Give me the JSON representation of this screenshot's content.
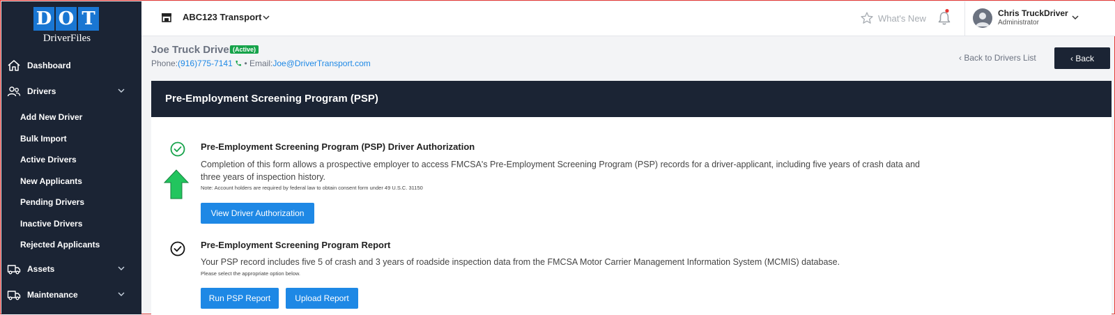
{
  "sidebar": {
    "logo_letters": [
      "D",
      "O",
      "T"
    ],
    "logo_sub": "DriverFiles",
    "items": [
      {
        "label": "Dashboard",
        "icon": "home-icon"
      },
      {
        "label": "Drivers",
        "icon": "users-icon"
      },
      {
        "label": "Assets",
        "icon": "truck-icon"
      },
      {
        "label": "Maintenance",
        "icon": "truck-icon"
      }
    ],
    "sub_items": [
      "Add New Driver",
      "Bulk Import",
      "Active Drivers",
      "New Applicants",
      "Pending Drivers",
      "Inactive Drivers",
      "Rejected Applicants"
    ]
  },
  "topbar": {
    "company": "ABC123 Transport",
    "whats_new": "What's New",
    "user_name": "Chris TruckDriver",
    "user_role": "Administrator"
  },
  "driver": {
    "name": "Joe Truck Driver",
    "status": "(Active)",
    "phone_label": "Phone:",
    "phone": "(916)775-7141",
    "email_label": "Email:",
    "email": "Joe@DriverTransport.com"
  },
  "nav": {
    "back_link": "Back to Drivers List",
    "back_button": "Back"
  },
  "panel": {
    "title": "Pre-Employment Screening Program (PSP)",
    "sections": [
      {
        "title": "Pre-Employment Screening Program (PSP) Driver Authorization",
        "desc_line1": "Completion of this form allows a prospective employer to access FMCSA's Pre-Employment Screening Program (PSP) records for a driver-applicant, including five years of crash data and",
        "desc_line2": "three years of inspection history.",
        "note": "Note: Account holders are required by federal law to obtain consent form under 49 U.S.C. 31150",
        "button": "View Driver Authorization"
      },
      {
        "title": "Pre-Employment Screening Program Report",
        "desc_line1": "Your PSP record includes five 5 of crash and 3 years of roadside inspection data from the FMCSA Motor Carrier Management Information System (MCMIS) database.",
        "note": "Please select the appropriate option below.",
        "button1": "Run PSP Report",
        "button2": "Upload Report"
      }
    ]
  },
  "colors": {
    "sidebar_bg": "#1b2434",
    "accent": "#1e88e5",
    "active_badge": "#16a34a",
    "annotation_arrow": "#22c55e"
  }
}
